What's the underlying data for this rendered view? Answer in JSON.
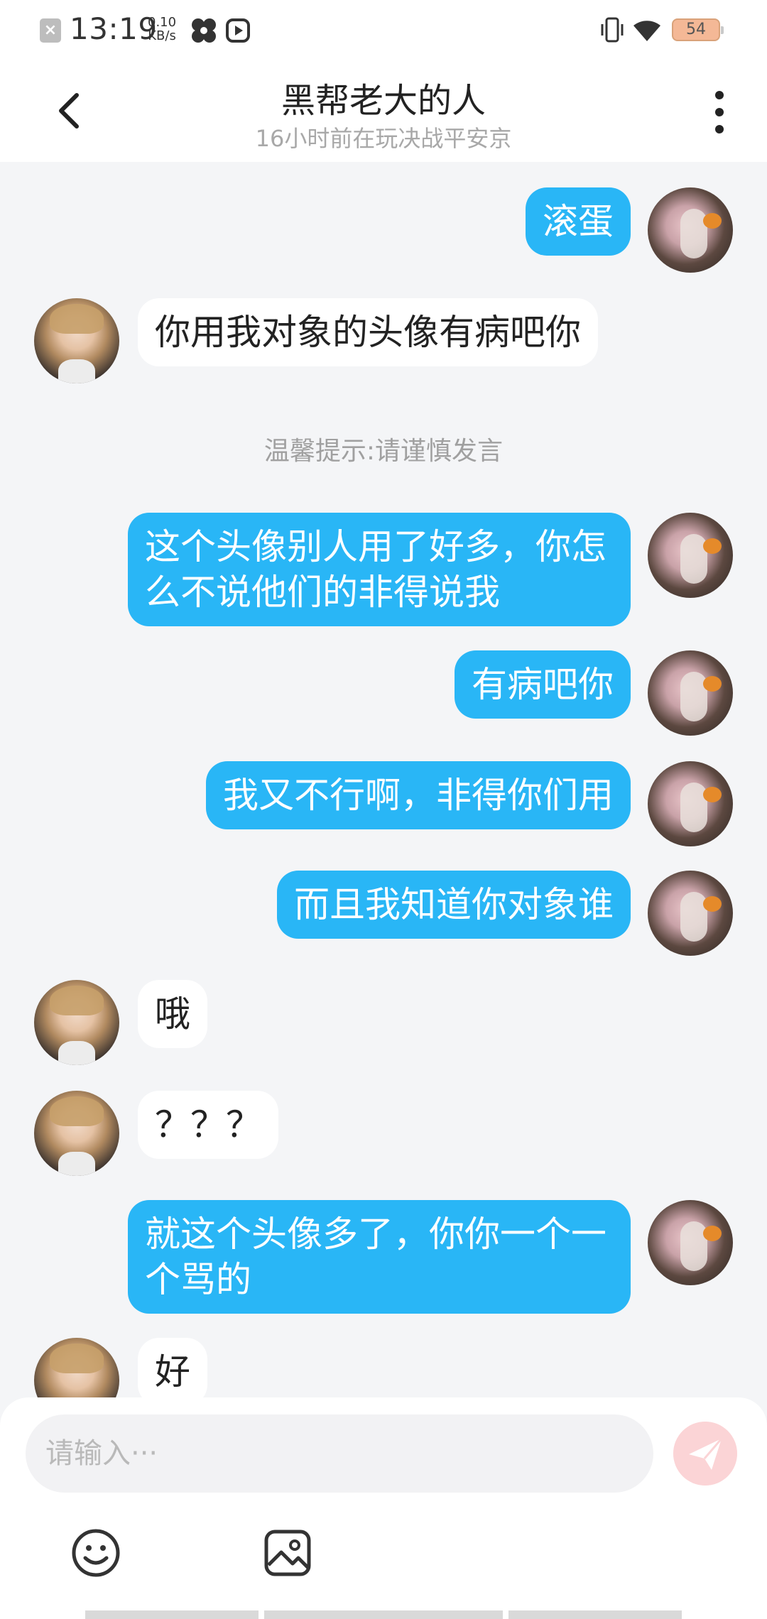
{
  "status_bar": {
    "time": "13:19",
    "net_speed_value": "0.10",
    "net_speed_unit": "KB/s",
    "battery": "54"
  },
  "header": {
    "title": "黑帮老大的人",
    "subtitle": "16小时前在玩决战平安京"
  },
  "messages": [
    {
      "sender": "me",
      "text": "滚蛋"
    },
    {
      "sender": "them",
      "text": "你用我对象的头像有病吧你"
    },
    {
      "type": "notice",
      "text": "温馨提示:请谨慎发言"
    },
    {
      "sender": "me",
      "text": "这个头像别人用了好多，你怎么不说他们的非得说我"
    },
    {
      "sender": "me",
      "text": "有病吧你"
    },
    {
      "sender": "me",
      "text": "我又不行啊，非得你们用"
    },
    {
      "sender": "me",
      "text": "而且我知道你对象谁"
    },
    {
      "sender": "them",
      "text": "哦"
    },
    {
      "sender": "them",
      "text": "？？？"
    },
    {
      "sender": "me",
      "text": "就这个头像多了，你你一个一个骂的"
    },
    {
      "sender": "them",
      "text": "好"
    }
  ],
  "input": {
    "placeholder": "请输入···"
  },
  "colors": {
    "my_bubble": "#29b6f6",
    "their_bubble": "#ffffff",
    "background": "#f4f5f7",
    "send_button": "#fbd4d6"
  },
  "icons": {
    "back": "chevron-left-icon",
    "more": "more-vertical-icon",
    "send": "paper-plane-icon",
    "emoji": "smiley-icon",
    "image": "image-icon"
  }
}
